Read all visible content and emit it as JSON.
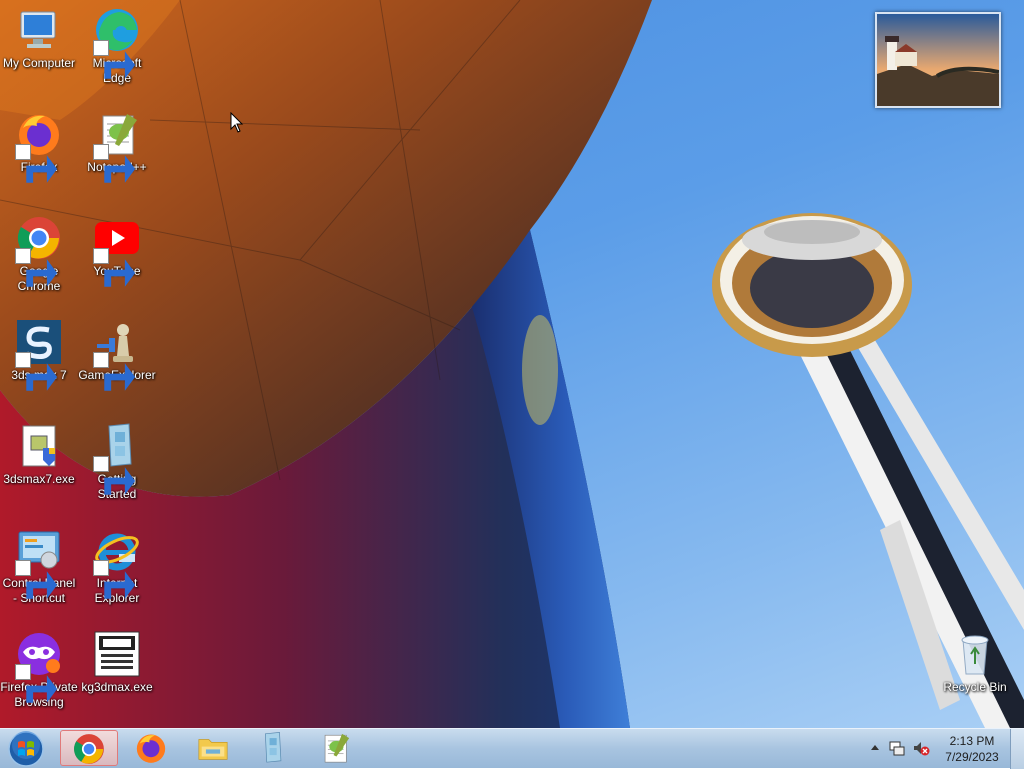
{
  "desktop": {
    "icons": [
      {
        "id": "my-computer",
        "label": "My Computer",
        "icon": "computer-icon"
      },
      {
        "id": "edge",
        "label": "Microsoft Edge",
        "icon": "edge-icon"
      },
      {
        "id": "firefox",
        "label": "Firefox",
        "icon": "firefox-icon"
      },
      {
        "id": "notepadpp",
        "label": "Notepad++",
        "icon": "notepadpp-icon"
      },
      {
        "id": "chrome",
        "label": "Google Chrome",
        "icon": "chrome-icon"
      },
      {
        "id": "youtube",
        "label": "YouTube",
        "icon": "youtube-icon"
      },
      {
        "id": "3dsmax7",
        "label": "3ds max 7",
        "icon": "3dsmax-icon"
      },
      {
        "id": "gameexplorer",
        "label": "GameExplorer",
        "icon": "game-explorer-icon"
      },
      {
        "id": "3dsmax7exe",
        "label": "3dsmax7.exe",
        "icon": "exe-icon"
      },
      {
        "id": "getting-started",
        "label": "Getting Started",
        "icon": "getting-started-icon"
      },
      {
        "id": "control-panel",
        "label": "Control Panel - Shortcut",
        "icon": "control-panel-icon"
      },
      {
        "id": "ie",
        "label": "Internet Explorer",
        "icon": "internet-explorer-icon"
      },
      {
        "id": "ff-private",
        "label": "Firefox Private Browsing",
        "icon": "firefox-private-icon"
      },
      {
        "id": "kg3dmax",
        "label": "kg3dmax.exe",
        "icon": "kg3dmax-icon"
      },
      {
        "id": "recycle-bin",
        "label": "Recycle Bin",
        "icon": "recycle-bin-icon"
      }
    ]
  },
  "taskbar": {
    "pinned": [
      {
        "id": "chrome",
        "icon": "chrome-icon",
        "active": true
      },
      {
        "id": "firefox",
        "icon": "firefox-icon",
        "active": false
      },
      {
        "id": "explorer",
        "icon": "folder-icon",
        "active": false
      },
      {
        "id": "getting-started",
        "icon": "getting-started-icon",
        "active": false
      },
      {
        "id": "notepadpp",
        "icon": "notepadpp-icon",
        "active": false
      }
    ],
    "clock": {
      "time": "2:13 PM",
      "date": "7/29/2023"
    }
  },
  "colors": {
    "accent": "#3a7bd5",
    "taskbar": "#a8c4e0",
    "active_task": "#e07a7a"
  }
}
